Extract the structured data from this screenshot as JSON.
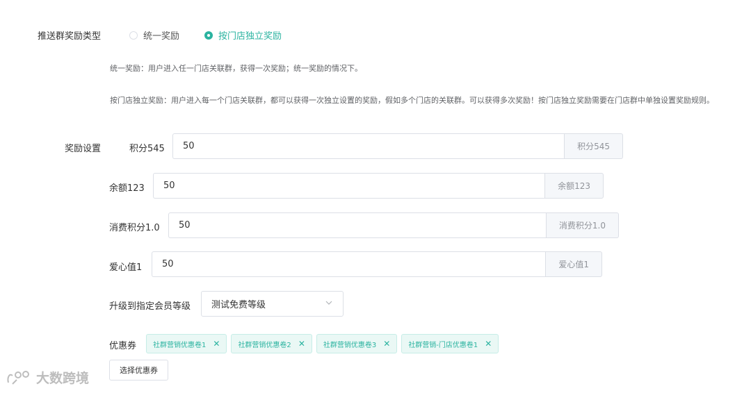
{
  "push_reward_type": {
    "label": "推送群奖励类型",
    "options": [
      {
        "label": "统一奖励",
        "checked": false
      },
      {
        "label": "按门店独立奖励",
        "checked": true
      }
    ],
    "desc_unified": "统一奖励：用户进入任一门店关联群，获得一次奖励；统一奖励的情况下。",
    "desc_per_store": "按门店独立奖励：用户进入每一个门店关联群，都可以获得一次独立设置的奖励，假如多个门店的关联群。可以获得多次奖励！按门店独立奖励需要在门店群中单独设置奖励规则。"
  },
  "reward_settings": {
    "label": "奖励设置",
    "fields": [
      {
        "label": "积分545",
        "value": "50",
        "unit": "积分545"
      },
      {
        "label": "余额123",
        "value": "50",
        "unit": "余额123"
      },
      {
        "label": "消费积分1.0",
        "value": "50",
        "unit": "消费积分1.0"
      },
      {
        "label": "爱心值1",
        "value": "50",
        "unit": "爱心值1"
      }
    ],
    "upgrade": {
      "label": "升级到指定会员等级",
      "selected": "测试免费等级"
    },
    "coupons": {
      "label": "优惠券",
      "tags": [
        "社群营销优惠卷1",
        "社群营销优惠卷2",
        "社群营销优惠卷3",
        "社群营销-门店优惠卷1"
      ],
      "select_button": "选择优惠券"
    }
  },
  "watermark": {
    "text": "大数跨境"
  },
  "colors": {
    "accent": "#2bb3a0",
    "border": "#dcdfe6",
    "append_bg": "#f5f7fa"
  }
}
